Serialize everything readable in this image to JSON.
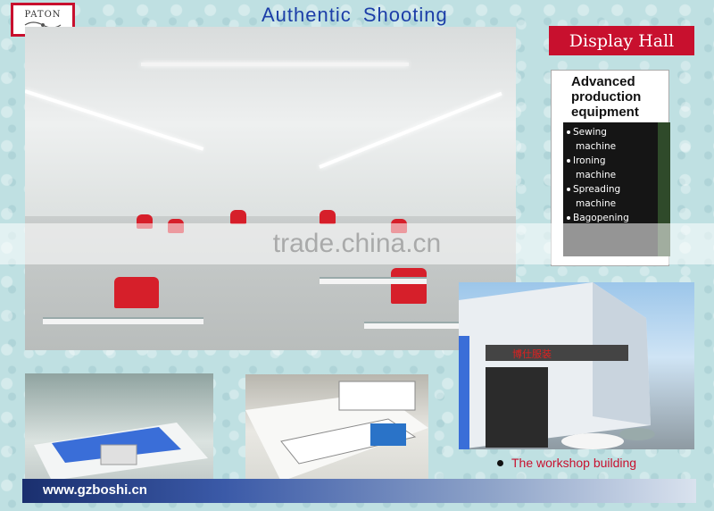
{
  "brand": {
    "name": "PATON"
  },
  "title": "Authentic  Shooting",
  "display_hall": {
    "label": "Display Hall"
  },
  "equipment": {
    "heading_lines": [
      "Advanced",
      "production",
      "equipment"
    ],
    "items": [
      {
        "line1": "Sewing",
        "line2": "machine"
      },
      {
        "line1": "Ironing",
        "line2": "machine"
      },
      {
        "line1": "Spreading",
        "line2": "machine"
      },
      {
        "line1": "Bagopening",
        "line2": ""
      }
    ]
  },
  "watermark": "trade.china.cn",
  "workshop": {
    "caption": "The workshop building",
    "sign_text": "博仕服装"
  },
  "footer": {
    "url": "www.gzboshi.cn"
  },
  "colors": {
    "accent_red": "#c8102e",
    "title_blue": "#1c3ea8",
    "footer_blue": "#1a2f6e"
  }
}
